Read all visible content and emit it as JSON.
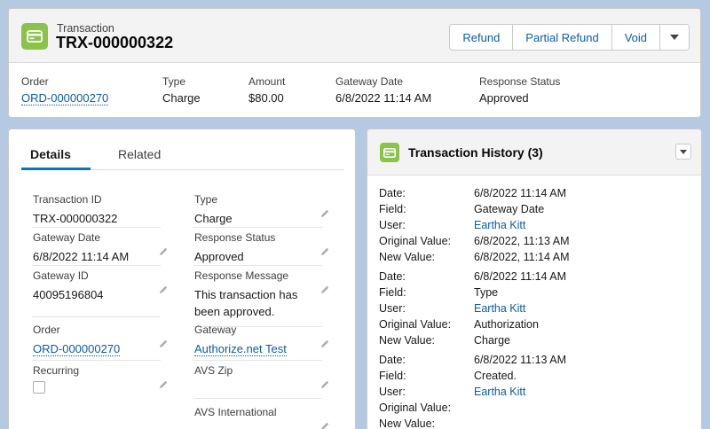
{
  "header": {
    "object_label": "Transaction",
    "record_name": "TRX-000000322",
    "icon": "card-icon",
    "actions": [
      "Refund",
      "Partial Refund",
      "Void"
    ],
    "highlights": [
      {
        "label": "Order",
        "value": "ORD-000000270",
        "link": true
      },
      {
        "label": "Type",
        "value": "Charge"
      },
      {
        "label": "Amount",
        "value": "$80.00"
      },
      {
        "label": "Gateway Date",
        "value": "6/8/2022 11:14 AM"
      },
      {
        "label": "Response Status",
        "value": "Approved"
      }
    ]
  },
  "details": {
    "tabs": [
      "Details",
      "Related"
    ],
    "active_tab": "Details",
    "fields": {
      "transaction_id": {
        "label": "Transaction ID",
        "value": "TRX-000000322"
      },
      "type": {
        "label": "Type",
        "value": "Charge"
      },
      "gateway_date": {
        "label": "Gateway Date",
        "value": "6/8/2022 11:14 AM"
      },
      "response_status": {
        "label": "Response Status",
        "value": "Approved"
      },
      "gateway_id": {
        "label": "Gateway ID",
        "value": "40095196804"
      },
      "response_message": {
        "label": "Response Message",
        "value_line1": "This transaction has",
        "value_line2": "been approved."
      },
      "order": {
        "label": "Order",
        "value": "ORD-000000270"
      },
      "gateway": {
        "label": "Gateway",
        "value": "Authorize.net Test"
      },
      "recurring": {
        "label": "Recurring",
        "checked": false
      },
      "avs_zip": {
        "label": "AVS Zip",
        "value": ""
      },
      "avs_international": {
        "label": "AVS International",
        "value": ""
      }
    }
  },
  "history": {
    "title": "Transaction History (3)",
    "labels": {
      "date": "Date:",
      "field": "Field:",
      "user": "User:",
      "original": "Original Value:",
      "new": "New Value:"
    },
    "entries": [
      {
        "date": "6/8/2022 11:14 AM",
        "field": "Gateway Date",
        "user": "Eartha Kitt",
        "original": "6/8/2022, 11:13 AM",
        "new": "6/8/2022, 11:14 AM"
      },
      {
        "date": "6/8/2022 11:14 AM",
        "field": "Type",
        "user": "Eartha Kitt",
        "original": "Authorization",
        "new": "Charge"
      },
      {
        "date": "6/8/2022 11:13 AM",
        "field": "Created.",
        "user": "Eartha Kitt",
        "original": "",
        "new": ""
      }
    ]
  },
  "colors": {
    "accent": "#0176d3",
    "link": "#0b5cab",
    "icon_bg": "#8bc34a",
    "background": "#b6c9e3"
  }
}
